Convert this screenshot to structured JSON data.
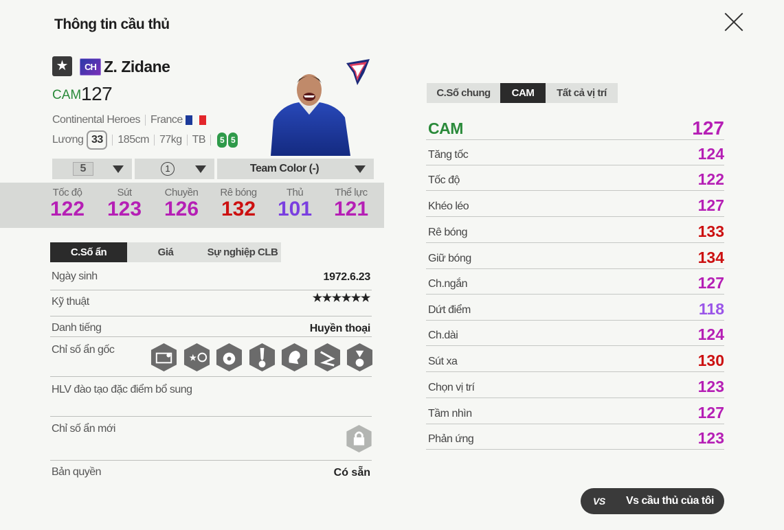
{
  "window": {
    "title": "Thông tin cầu thủ"
  },
  "player": {
    "season_badge": "CH",
    "name": "Z. Zidane",
    "position": "CAM",
    "ovr": "127",
    "season_name": "Continental Heroes",
    "nation": "France",
    "salary_label": "Lương",
    "salary": "33",
    "height": "185cm",
    "weight": "77kg",
    "body": "TB",
    "weak_foot_left": "5",
    "weak_foot_right": "5"
  },
  "selectors": {
    "upgrade": "5",
    "level": "1",
    "team_color": "Team Color (-)"
  },
  "stats": [
    {
      "label": "Tốc độ",
      "value": "122",
      "color": "#b51fb5"
    },
    {
      "label": "Sút",
      "value": "123",
      "color": "#b51fb5"
    },
    {
      "label": "Chuyền",
      "value": "126",
      "color": "#b51fb5"
    },
    {
      "label": "Rê bóng",
      "value": "132",
      "color": "#cc1111"
    },
    {
      "label": "Thủ",
      "value": "101",
      "color": "#7a3fe0"
    },
    {
      "label": "Thể lực",
      "value": "121",
      "color": "#b51fb5"
    }
  ],
  "left_tabs": [
    "C.Số ẩn",
    "Giá",
    "Sự nghiệp CLB"
  ],
  "details": {
    "birth_label": "Ngày sinh",
    "birth": "1972.6.23",
    "skill_label": "Kỹ thuật",
    "skill_stars": 6,
    "rep_label": "Danh tiếng",
    "rep": "Huyền thoại",
    "traits_label": "Chỉ số ẩn gốc",
    "traits": [
      "goalkeeper-net-icon",
      "star-swirl-icon",
      "soccer-ball-icon",
      "tie-ball-icon",
      "lion-head-icon",
      "route-icon",
      "beach-ball-icon"
    ],
    "coach_label": "HLV đào tạo đặc điểm bổ sung",
    "new_label": "Chỉ số ẩn mới",
    "copyright_label": "Bản quyền",
    "copyright": "Có sẵn"
  },
  "right_tabs": [
    "C.Số chung",
    "CAM",
    "Tất cả vị trí"
  ],
  "position_stats": {
    "header": {
      "label": "CAM",
      "value": "127"
    },
    "rows": [
      {
        "label": "Tăng tốc",
        "value": "124",
        "color": "#b51fb5"
      },
      {
        "label": "Tốc độ",
        "value": "122",
        "color": "#b51fb5"
      },
      {
        "label": "Khéo léo",
        "value": "127",
        "color": "#b51fb5"
      },
      {
        "label": "Rê bóng",
        "value": "133",
        "color": "#cc1111"
      },
      {
        "label": "Giữ bóng",
        "value": "134",
        "color": "#cc1111"
      },
      {
        "label": "Ch.ngắn",
        "value": "127",
        "color": "#b51fb5"
      },
      {
        "label": "Dứt điểm",
        "value": "118",
        "color": "#9a55e8"
      },
      {
        "label": "Ch.dài",
        "value": "124",
        "color": "#b51fb5"
      },
      {
        "label": "Sút xa",
        "value": "130",
        "color": "#cc1111"
      },
      {
        "label": "Chọn vị trí",
        "value": "123",
        "color": "#b51fb5"
      },
      {
        "label": "Tầm nhìn",
        "value": "127",
        "color": "#b51fb5"
      },
      {
        "label": "Phản ứng",
        "value": "123",
        "color": "#b51fb5"
      }
    ]
  },
  "compare_button": {
    "icon_text": "VS",
    "label": "Vs cầu thủ của tôi"
  }
}
